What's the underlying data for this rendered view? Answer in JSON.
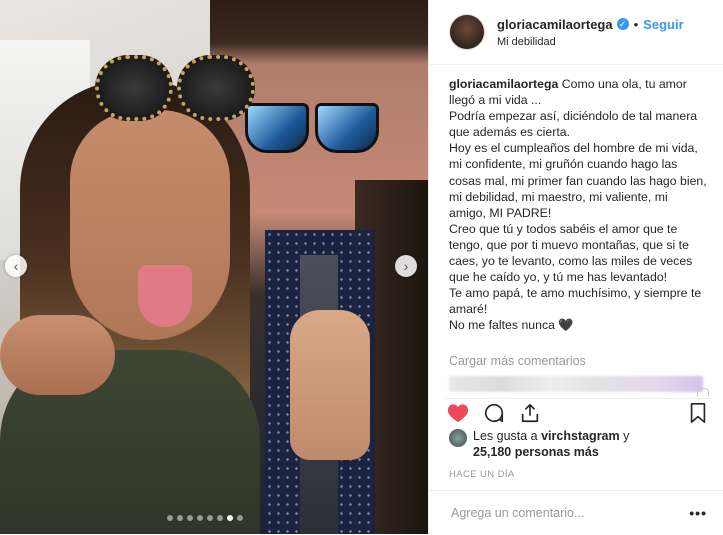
{
  "post": {
    "username": "gloriacamilaortega",
    "follow_label": "Seguir",
    "separator": "•",
    "location": "Mi debilidad",
    "verified_glyph": "✓",
    "caption_lines": [
      "Como una ola, tu amor llegó a mi vida ...",
      "Podría empezar así, diciéndolo de tal manera que además es cierta.",
      "Hoy es el cumpleaños del hombre de mi vida, mi confidente, mi gruñón cuando hago las cosas mal, mi primer fan cuando las hago bien, mi debilidad, mi maestro, mi valiente, mi amigo, MI PADRE!",
      "Creo que tú y todos sabéis el amor que te tengo, que por ti muevo montañas, que si te caes, yo te levanto, como las miles de veces que he caído yo, y tú me has levantado!",
      "Te amo papá, te amo muchísimo, y siempre te amaré!",
      "No me faltes nunca 🖤"
    ],
    "load_more": "Cargar más comentarios",
    "likes_prefix": "Les gusta a ",
    "likes_user": "virchstagram",
    "likes_mid": " y",
    "likes_count": "25,180 personas más",
    "time": "HACE UN DÍA",
    "comment_placeholder": "Agrega un comentario...",
    "more_label": "•••",
    "carousel": {
      "prev": "‹",
      "next": "›",
      "total_dots": 8,
      "active_dot": 6
    }
  },
  "icons": {
    "like": "heart-icon-filled",
    "comment": "comment-icon",
    "share": "share-icon",
    "save": "bookmark-icon"
  },
  "colors": {
    "like_red": "#ed4956",
    "link_blue": "#3897f0",
    "muted": "#999999"
  }
}
